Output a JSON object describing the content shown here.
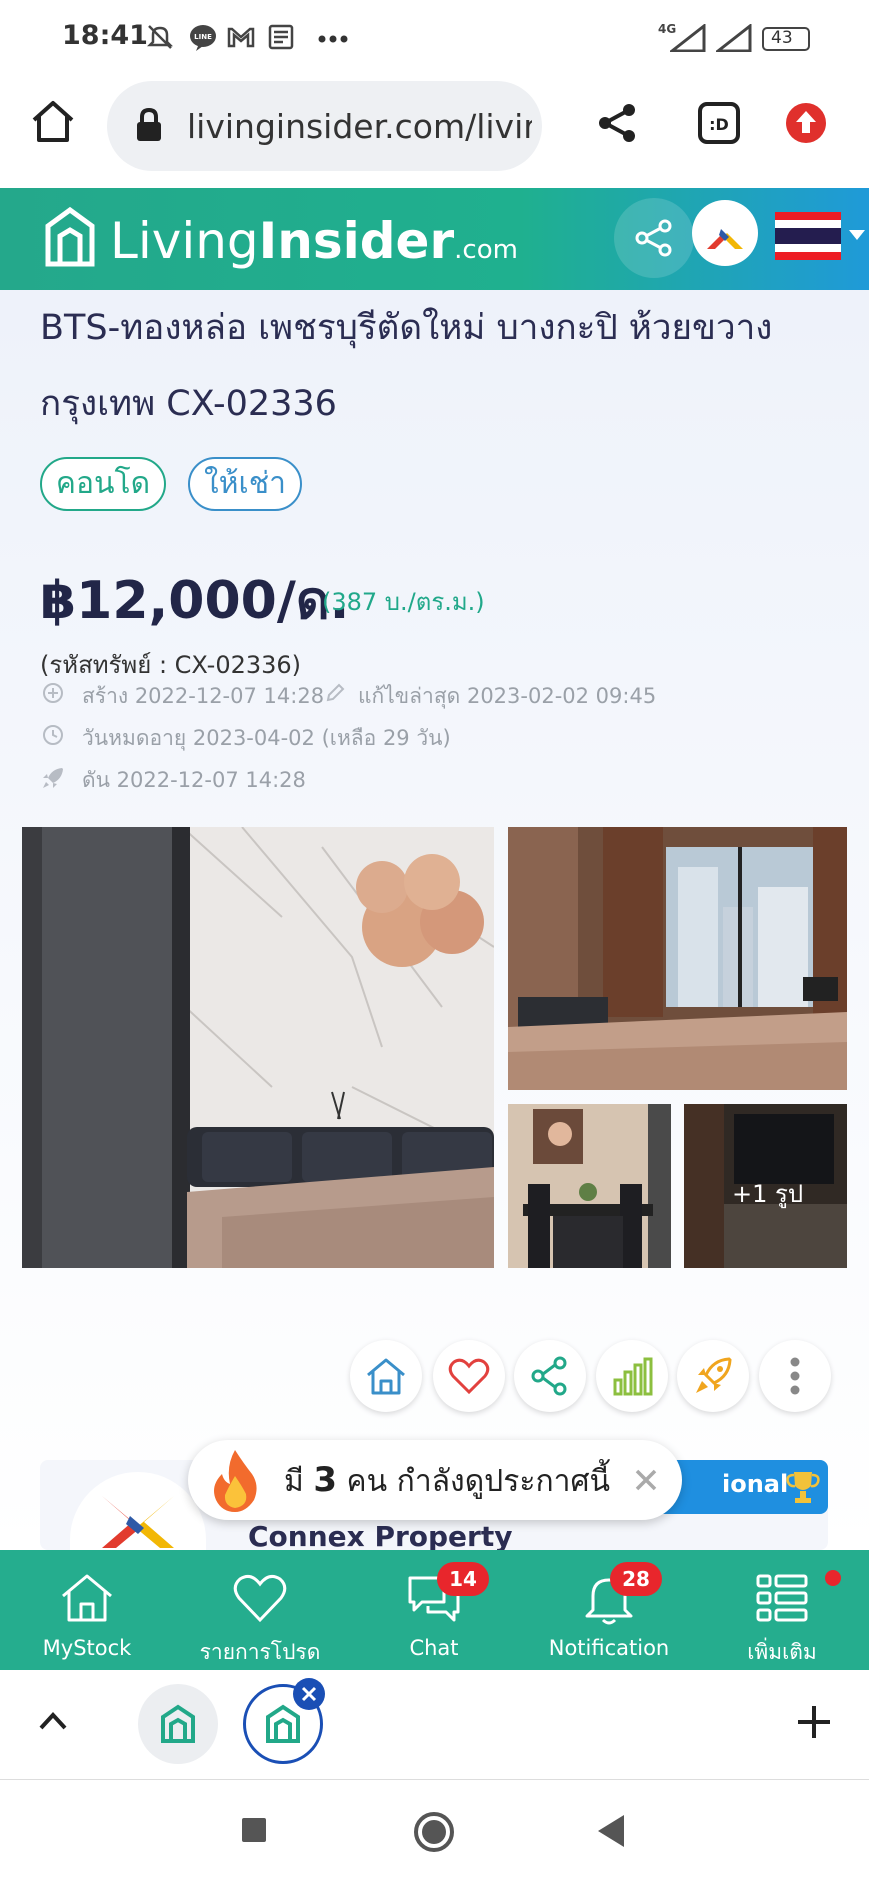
{
  "status_bar": {
    "time": "18:41",
    "network": "4G",
    "battery": "43"
  },
  "browser": {
    "url": "livinginsider.com/livir"
  },
  "site": {
    "logo_living": "Living",
    "logo_insider": "Insider",
    "logo_com": ".com"
  },
  "listing": {
    "title_line1": "BTS-ทองหล่อ เพชรบุรีตัดใหม่ บางกะปิ ห้วยขวาง",
    "title_line2": "กรุงเทพ CX-02336",
    "tags": [
      "คอนโด",
      "ให้เช่า"
    ],
    "price": "฿12,000/ด.",
    "price_per_sqm": "(387 บ./ตร.ม.)",
    "property_code": "(รหัสทรัพย์ : CX-02336)",
    "created": "สร้าง 2022-12-07 14:28",
    "edited": "แก้ไขล่าสุด 2023-02-02 09:45",
    "expires": "วันหมดอายุ 2023-04-02  (เหลือ 29 วัน)",
    "boosted": "ดัน 2022-12-07 14:28",
    "more_photos": "+1 รูป"
  },
  "viewers_toast": {
    "prefix": "มี",
    "count": "3",
    "suffix": "คน กำลังดูประกาศนี้"
  },
  "agent": {
    "name": "Connex Property",
    "badge": "ional"
  },
  "bottom_nav": {
    "items": [
      {
        "label": "MyStock"
      },
      {
        "label": "รายการโปรด"
      },
      {
        "label": "Chat",
        "badge": "14"
      },
      {
        "label": "Notification",
        "badge": "28"
      },
      {
        "label": "เพิ่มเติม"
      }
    ]
  },
  "colors": {
    "brand_green": "#25ad8e",
    "title_navy": "#2b2d52",
    "badge_red": "#e8262c"
  }
}
